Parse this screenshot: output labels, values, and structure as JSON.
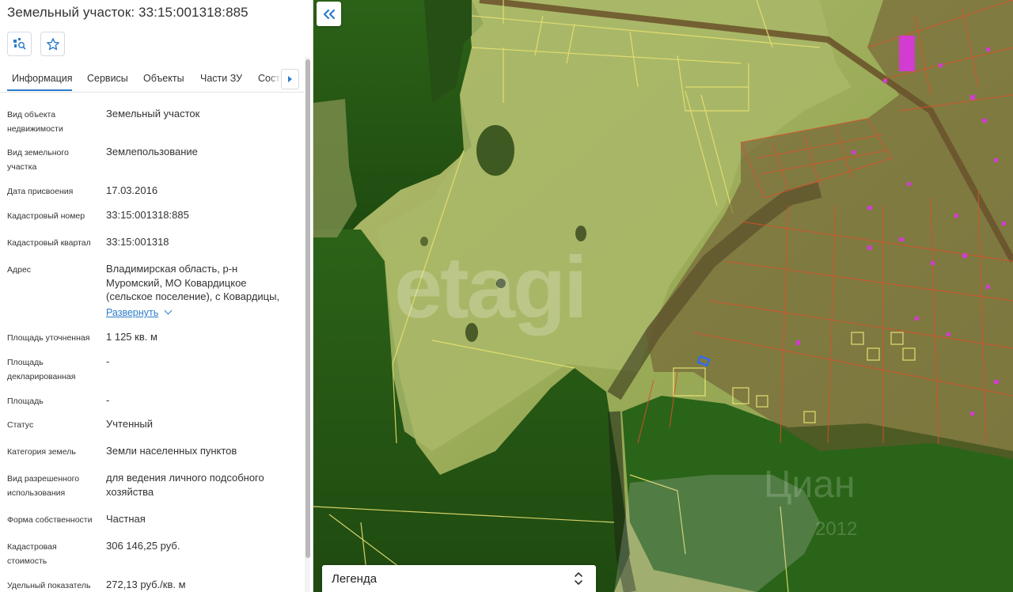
{
  "panel": {
    "title": "Земельный участок: 33:15:001318:885",
    "tabs": [
      "Информация",
      "Сервисы",
      "Объекты",
      "Части ЗУ",
      "Соста"
    ],
    "expand_label": "Развернуть",
    "rows": [
      {
        "label": "Вид объекта недвижимости",
        "value": "Земельный участок"
      },
      {
        "label": "Вид земельного участка",
        "value": "Землепользование"
      },
      {
        "label": "Дата присвоения",
        "value": "17.03.2016"
      },
      {
        "label": "Кадастровый номер",
        "value": "33:15:001318:885"
      },
      {
        "label": "Кадастровый квартал",
        "value": "33:15:001318"
      },
      {
        "label": "Адрес",
        "value": "Владимирская область, р-н Муромский, МО Ковардицкое (сельское поселение), с Ковардицы,"
      },
      {
        "label": "Площадь уточненная",
        "value": "1 125 кв. м"
      },
      {
        "label": "Площадь декларированная",
        "value": "-"
      },
      {
        "label": "Площадь",
        "value": "-"
      },
      {
        "label": "Статус",
        "value": "Учтенный"
      },
      {
        "label": "Категория земель",
        "value": "Земли населенных пунктов"
      },
      {
        "label": "Вид разрешенного использования",
        "value": "для ведения личного подсобного хозяйства"
      },
      {
        "label": "Форма собственности",
        "value": "Частная"
      },
      {
        "label": "Кадастровая стоимость",
        "value": "306 146,25 руб."
      },
      {
        "label": "Удельный показатель",
        "value": "272,13 руб./кв. м"
      }
    ]
  },
  "map": {
    "collapse_icon": "double-chevron-left-icon",
    "legend_label": "Легенда",
    "watermarks": [
      "etagi",
      "Циан",
      "2012"
    ]
  },
  "colors": {
    "accent": "#2d7cc9",
    "field": "#9aab55",
    "forest": "#2f6a1a",
    "parcel_line": "#e8e070",
    "urban_line": "#d8502a",
    "building": "#d23cd0",
    "selected_parcel": "#2a6cff"
  }
}
